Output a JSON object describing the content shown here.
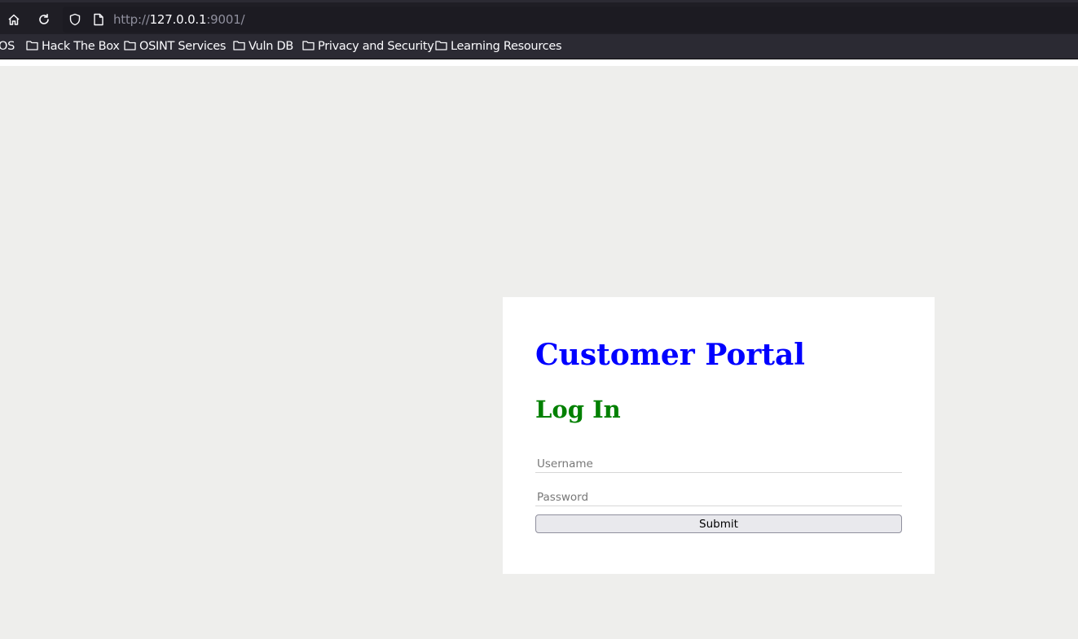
{
  "browser": {
    "url_scheme": "http://",
    "url_host": "127.0.0.1",
    "url_rest": ":9001/",
    "icons": {
      "home": "home-icon",
      "reload": "reload-icon",
      "tracking": "shield-icon",
      "page": "page-icon",
      "folder": "folder-icon"
    },
    "bookmarks": [
      {
        "label": "OS"
      },
      {
        "label": "Hack The Box"
      },
      {
        "label": "OSINT Services"
      },
      {
        "label": "Vuln DB"
      },
      {
        "label": "Privacy and Security"
      },
      {
        "label": "Learning Resources"
      }
    ]
  },
  "page": {
    "title": "Customer Portal",
    "subtitle": "Log In",
    "form": {
      "username_placeholder": "Username",
      "username_value": "",
      "password_placeholder": "Password",
      "password_value": "",
      "submit_label": "Submit"
    }
  },
  "colors": {
    "title": "#0000ff",
    "subtitle": "#008000",
    "page_background": "#eeeeec",
    "card_background": "#ffffff",
    "toolbar_background": "#1f1e25",
    "bookmarks_background": "#2b2a33"
  }
}
